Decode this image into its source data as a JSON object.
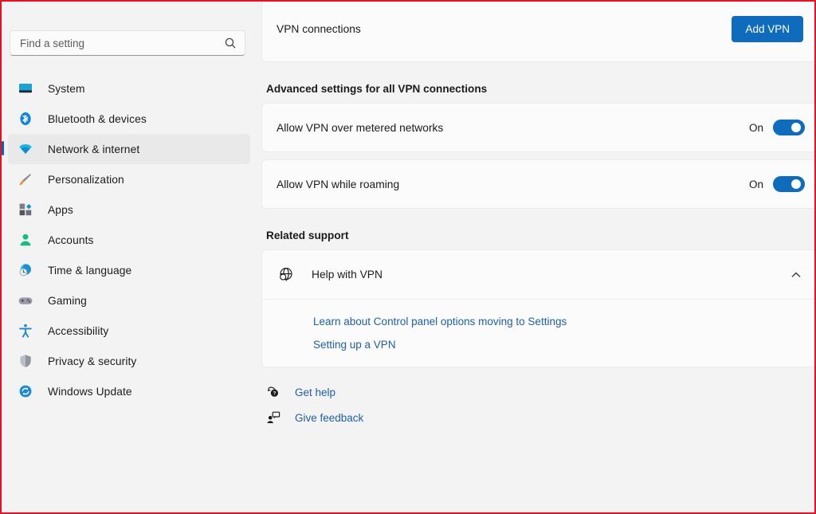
{
  "search": {
    "placeholder": "Find a setting",
    "value": "",
    "icon": "search-icon"
  },
  "sidebar": {
    "items": [
      {
        "label": "System",
        "icon": "monitor-icon",
        "selected": false
      },
      {
        "label": "Bluetooth & devices",
        "icon": "bluetooth-icon",
        "selected": false
      },
      {
        "label": "Network & internet",
        "icon": "wifi-icon",
        "selected": true
      },
      {
        "label": "Personalization",
        "icon": "paintbrush-icon",
        "selected": false
      },
      {
        "label": "Apps",
        "icon": "apps-icon",
        "selected": false
      },
      {
        "label": "Accounts",
        "icon": "person-icon",
        "selected": false
      },
      {
        "label": "Time & language",
        "icon": "clock-globe-icon",
        "selected": false
      },
      {
        "label": "Gaming",
        "icon": "gamepad-icon",
        "selected": false
      },
      {
        "label": "Accessibility",
        "icon": "accessibility-icon",
        "selected": false
      },
      {
        "label": "Privacy & security",
        "icon": "shield-icon",
        "selected": false
      },
      {
        "label": "Windows Update",
        "icon": "update-icon",
        "selected": false
      }
    ]
  },
  "main": {
    "vpn_connections": {
      "title": "VPN connections",
      "add_button": "Add VPN"
    },
    "advanced": {
      "heading": "Advanced settings for all VPN connections",
      "settings": [
        {
          "label": "Allow VPN over metered networks",
          "state": "On",
          "checked": true
        },
        {
          "label": "Allow VPN while roaming",
          "state": "On",
          "checked": true
        }
      ]
    },
    "related_support": {
      "heading": "Related support",
      "item": {
        "title": "Help with VPN",
        "icon": "globe-search-icon",
        "expanded": true,
        "chevron": "chevron-up-icon",
        "links": [
          "Learn about Control panel options moving to Settings",
          "Setting up a VPN"
        ]
      }
    },
    "footer_links": [
      {
        "label": "Get help",
        "icon": "help-bubble-icon"
      },
      {
        "label": "Give feedback",
        "icon": "feedback-person-icon"
      }
    ]
  },
  "colors": {
    "accent": "#0f6cbd",
    "link": "#1f5fa8",
    "page_bg": "#f3f3f3",
    "card_bg": "#fbfbfb",
    "frame": "#e81123"
  }
}
